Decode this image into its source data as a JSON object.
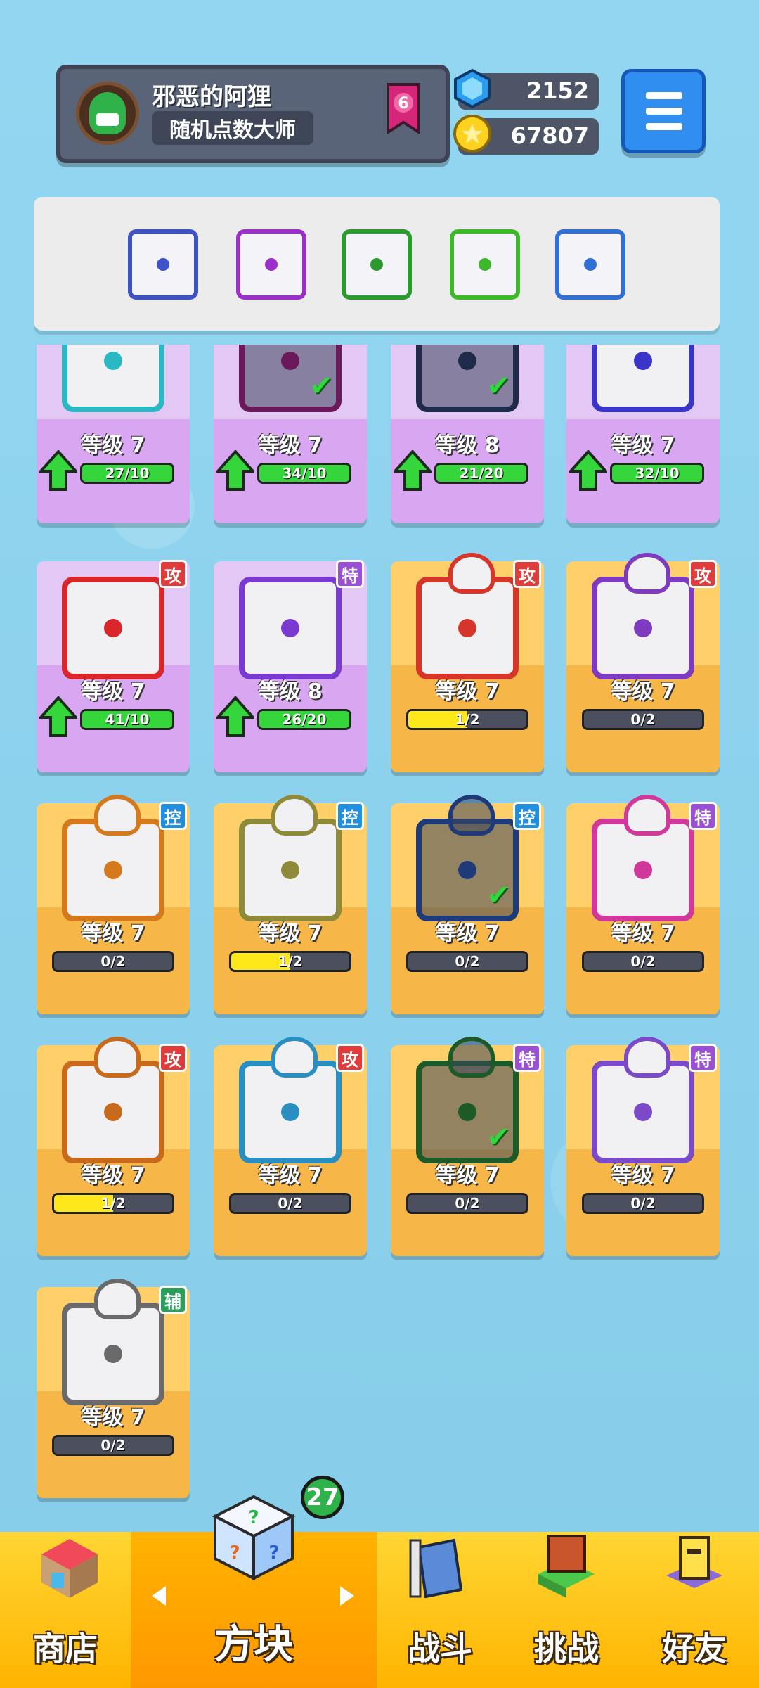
{
  "profile": {
    "name": "邪恶的阿狸",
    "title": "随机点数大师",
    "rank": "6"
  },
  "currency": {
    "gems": "2152",
    "coins": "67807"
  },
  "colors": {
    "tag_attack": "#e23b3b",
    "tag_special": "#9b4fd6",
    "tag_control": "#1f8fe0",
    "tag_support": "#28a05a",
    "progress_green": "#35d63b",
    "progress_yellow": "#ffe81a"
  },
  "tags": {
    "attack": "攻",
    "special": "特",
    "control": "控",
    "support": "辅"
  },
  "deck": [
    {
      "name": "gear-dice",
      "color": "#3b52c8"
    },
    {
      "name": "teleport-dice",
      "color": "#9b2fc9"
    },
    {
      "name": "thorn-dragon-dice",
      "color": "#2b9b30"
    },
    {
      "name": "poison-dice",
      "color": "#3cb828"
    },
    {
      "name": "ice-dragon-dice",
      "color": "#2f6fd6"
    }
  ],
  "dice": [
    {
      "level": "等级 7",
      "progress": "27/10",
      "fill": 1.0,
      "upgradable": true,
      "rarity": "purple",
      "color": "#2ab9c4",
      "tag": null,
      "checked": false,
      "dragon": false
    },
    {
      "level": "等级 7",
      "progress": "34/10",
      "fill": 1.0,
      "upgradable": true,
      "rarity": "purple",
      "color": "#6a1a5a",
      "tag": null,
      "checked": true,
      "dragon": false
    },
    {
      "level": "等级 8",
      "progress": "21/20",
      "fill": 1.0,
      "upgradable": true,
      "rarity": "purple",
      "color": "#1f2a4a",
      "tag": null,
      "checked": true,
      "dragon": false
    },
    {
      "level": "等级 7",
      "progress": "32/10",
      "fill": 1.0,
      "upgradable": true,
      "rarity": "purple",
      "color": "#3a34c8",
      "tag": null,
      "checked": false,
      "dragon": false
    },
    {
      "level": "等级 7",
      "progress": "41/10",
      "fill": 1.0,
      "upgradable": true,
      "rarity": "purple",
      "color": "#d8262a",
      "tag": "attack",
      "checked": false,
      "dragon": false
    },
    {
      "level": "等级 8",
      "progress": "26/20",
      "fill": 1.0,
      "upgradable": true,
      "rarity": "purple",
      "color": "#7a3ad0",
      "tag": "special",
      "checked": false,
      "dragon": false
    },
    {
      "level": "等级 7",
      "progress": "1/2",
      "fill": 0.5,
      "upgradable": false,
      "rarity": "orange",
      "color": "#d6352a",
      "tag": "attack",
      "checked": false,
      "dragon": true
    },
    {
      "level": "等级 7",
      "progress": "0/2",
      "fill": 0,
      "upgradable": false,
      "rarity": "orange",
      "color": "#7e3bbf",
      "tag": "attack",
      "checked": false,
      "dragon": true
    },
    {
      "level": "等级 7",
      "progress": "0/2",
      "fill": 0,
      "upgradable": false,
      "rarity": "orange",
      "color": "#d57a1c",
      "tag": "control",
      "checked": false,
      "dragon": true
    },
    {
      "level": "等级 7",
      "progress": "1/2",
      "fill": 0.5,
      "upgradable": false,
      "rarity": "orange",
      "color": "#8f8a3a",
      "tag": "control",
      "checked": false,
      "dragon": true
    },
    {
      "level": "等级 7",
      "progress": "0/2",
      "fill": 0,
      "upgradable": false,
      "rarity": "orange",
      "color": "#1f3a78",
      "tag": "control",
      "checked": true,
      "dragon": true
    },
    {
      "level": "等级 7",
      "progress": "0/2",
      "fill": 0,
      "upgradable": false,
      "rarity": "orange",
      "color": "#d0389a",
      "tag": "special",
      "checked": false,
      "dragon": true
    },
    {
      "level": "等级 7",
      "progress": "1/2",
      "fill": 0.5,
      "upgradable": false,
      "rarity": "orange",
      "color": "#c86a1c",
      "tag": "attack",
      "checked": false,
      "dragon": true
    },
    {
      "level": "等级 7",
      "progress": "0/2",
      "fill": 0,
      "upgradable": false,
      "rarity": "orange",
      "color": "#2a8fc0",
      "tag": "attack",
      "checked": false,
      "dragon": true
    },
    {
      "level": "等级 7",
      "progress": "0/2",
      "fill": 0,
      "upgradable": false,
      "rarity": "orange",
      "color": "#1e5a28",
      "tag": "special",
      "checked": true,
      "dragon": true
    },
    {
      "level": "等级 7",
      "progress": "0/2",
      "fill": 0,
      "upgradable": false,
      "rarity": "orange",
      "color": "#7a4ac8",
      "tag": "special",
      "checked": false,
      "dragon": true
    },
    {
      "level": "等级 7",
      "progress": "0/2",
      "fill": 0,
      "upgradable": false,
      "rarity": "orange",
      "color": "#6a6a6a",
      "tag": "support",
      "checked": false,
      "dragon": true
    }
  ],
  "nav": {
    "shop": "商店",
    "dice": "方块",
    "battle": "战斗",
    "challenge": "挑战",
    "friends": "好友",
    "dice_count": "27"
  }
}
